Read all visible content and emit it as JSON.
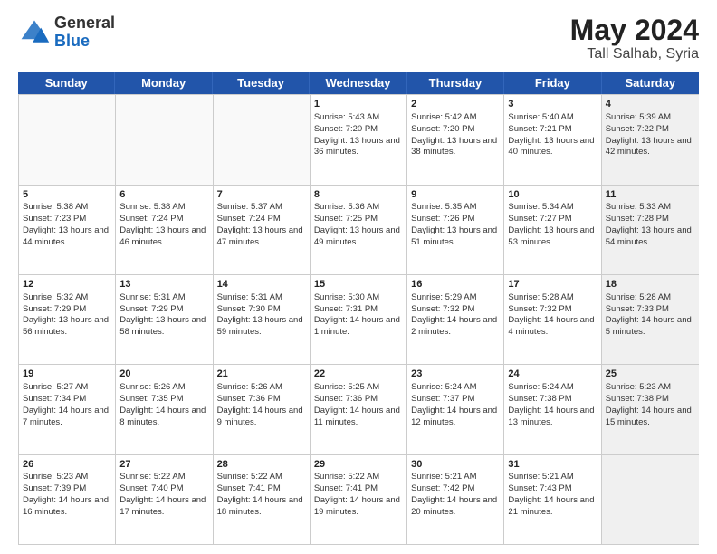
{
  "logo": {
    "general": "General",
    "blue": "Blue"
  },
  "title": {
    "month_year": "May 2024",
    "location": "Tall Salhab, Syria"
  },
  "header_days": [
    "Sunday",
    "Monday",
    "Tuesday",
    "Wednesday",
    "Thursday",
    "Friday",
    "Saturday"
  ],
  "weeks": [
    [
      {
        "day": "",
        "sunrise": "",
        "sunset": "",
        "daylight": "",
        "shaded": false,
        "empty": true
      },
      {
        "day": "",
        "sunrise": "",
        "sunset": "",
        "daylight": "",
        "shaded": false,
        "empty": true
      },
      {
        "day": "",
        "sunrise": "",
        "sunset": "",
        "daylight": "",
        "shaded": false,
        "empty": true
      },
      {
        "day": "1",
        "sunrise": "Sunrise: 5:43 AM",
        "sunset": "Sunset: 7:20 PM",
        "daylight": "Daylight: 13 hours and 36 minutes.",
        "shaded": false,
        "empty": false
      },
      {
        "day": "2",
        "sunrise": "Sunrise: 5:42 AM",
        "sunset": "Sunset: 7:20 PM",
        "daylight": "Daylight: 13 hours and 38 minutes.",
        "shaded": false,
        "empty": false
      },
      {
        "day": "3",
        "sunrise": "Sunrise: 5:40 AM",
        "sunset": "Sunset: 7:21 PM",
        "daylight": "Daylight: 13 hours and 40 minutes.",
        "shaded": false,
        "empty": false
      },
      {
        "day": "4",
        "sunrise": "Sunrise: 5:39 AM",
        "sunset": "Sunset: 7:22 PM",
        "daylight": "Daylight: 13 hours and 42 minutes.",
        "shaded": true,
        "empty": false
      }
    ],
    [
      {
        "day": "5",
        "sunrise": "Sunrise: 5:38 AM",
        "sunset": "Sunset: 7:23 PM",
        "daylight": "Daylight: 13 hours and 44 minutes.",
        "shaded": false,
        "empty": false
      },
      {
        "day": "6",
        "sunrise": "Sunrise: 5:38 AM",
        "sunset": "Sunset: 7:24 PM",
        "daylight": "Daylight: 13 hours and 46 minutes.",
        "shaded": false,
        "empty": false
      },
      {
        "day": "7",
        "sunrise": "Sunrise: 5:37 AM",
        "sunset": "Sunset: 7:24 PM",
        "daylight": "Daylight: 13 hours and 47 minutes.",
        "shaded": false,
        "empty": false
      },
      {
        "day": "8",
        "sunrise": "Sunrise: 5:36 AM",
        "sunset": "Sunset: 7:25 PM",
        "daylight": "Daylight: 13 hours and 49 minutes.",
        "shaded": false,
        "empty": false
      },
      {
        "day": "9",
        "sunrise": "Sunrise: 5:35 AM",
        "sunset": "Sunset: 7:26 PM",
        "daylight": "Daylight: 13 hours and 51 minutes.",
        "shaded": false,
        "empty": false
      },
      {
        "day": "10",
        "sunrise": "Sunrise: 5:34 AM",
        "sunset": "Sunset: 7:27 PM",
        "daylight": "Daylight: 13 hours and 53 minutes.",
        "shaded": false,
        "empty": false
      },
      {
        "day": "11",
        "sunrise": "Sunrise: 5:33 AM",
        "sunset": "Sunset: 7:28 PM",
        "daylight": "Daylight: 13 hours and 54 minutes.",
        "shaded": true,
        "empty": false
      }
    ],
    [
      {
        "day": "12",
        "sunrise": "Sunrise: 5:32 AM",
        "sunset": "Sunset: 7:29 PM",
        "daylight": "Daylight: 13 hours and 56 minutes.",
        "shaded": false,
        "empty": false
      },
      {
        "day": "13",
        "sunrise": "Sunrise: 5:31 AM",
        "sunset": "Sunset: 7:29 PM",
        "daylight": "Daylight: 13 hours and 58 minutes.",
        "shaded": false,
        "empty": false
      },
      {
        "day": "14",
        "sunrise": "Sunrise: 5:31 AM",
        "sunset": "Sunset: 7:30 PM",
        "daylight": "Daylight: 13 hours and 59 minutes.",
        "shaded": false,
        "empty": false
      },
      {
        "day": "15",
        "sunrise": "Sunrise: 5:30 AM",
        "sunset": "Sunset: 7:31 PM",
        "daylight": "Daylight: 14 hours and 1 minute.",
        "shaded": false,
        "empty": false
      },
      {
        "day": "16",
        "sunrise": "Sunrise: 5:29 AM",
        "sunset": "Sunset: 7:32 PM",
        "daylight": "Daylight: 14 hours and 2 minutes.",
        "shaded": false,
        "empty": false
      },
      {
        "day": "17",
        "sunrise": "Sunrise: 5:28 AM",
        "sunset": "Sunset: 7:32 PM",
        "daylight": "Daylight: 14 hours and 4 minutes.",
        "shaded": false,
        "empty": false
      },
      {
        "day": "18",
        "sunrise": "Sunrise: 5:28 AM",
        "sunset": "Sunset: 7:33 PM",
        "daylight": "Daylight: 14 hours and 5 minutes.",
        "shaded": true,
        "empty": false
      }
    ],
    [
      {
        "day": "19",
        "sunrise": "Sunrise: 5:27 AM",
        "sunset": "Sunset: 7:34 PM",
        "daylight": "Daylight: 14 hours and 7 minutes.",
        "shaded": false,
        "empty": false
      },
      {
        "day": "20",
        "sunrise": "Sunrise: 5:26 AM",
        "sunset": "Sunset: 7:35 PM",
        "daylight": "Daylight: 14 hours and 8 minutes.",
        "shaded": false,
        "empty": false
      },
      {
        "day": "21",
        "sunrise": "Sunrise: 5:26 AM",
        "sunset": "Sunset: 7:36 PM",
        "daylight": "Daylight: 14 hours and 9 minutes.",
        "shaded": false,
        "empty": false
      },
      {
        "day": "22",
        "sunrise": "Sunrise: 5:25 AM",
        "sunset": "Sunset: 7:36 PM",
        "daylight": "Daylight: 14 hours and 11 minutes.",
        "shaded": false,
        "empty": false
      },
      {
        "day": "23",
        "sunrise": "Sunrise: 5:24 AM",
        "sunset": "Sunset: 7:37 PM",
        "daylight": "Daylight: 14 hours and 12 minutes.",
        "shaded": false,
        "empty": false
      },
      {
        "day": "24",
        "sunrise": "Sunrise: 5:24 AM",
        "sunset": "Sunset: 7:38 PM",
        "daylight": "Daylight: 14 hours and 13 minutes.",
        "shaded": false,
        "empty": false
      },
      {
        "day": "25",
        "sunrise": "Sunrise: 5:23 AM",
        "sunset": "Sunset: 7:38 PM",
        "daylight": "Daylight: 14 hours and 15 minutes.",
        "shaded": true,
        "empty": false
      }
    ],
    [
      {
        "day": "26",
        "sunrise": "Sunrise: 5:23 AM",
        "sunset": "Sunset: 7:39 PM",
        "daylight": "Daylight: 14 hours and 16 minutes.",
        "shaded": false,
        "empty": false
      },
      {
        "day": "27",
        "sunrise": "Sunrise: 5:22 AM",
        "sunset": "Sunset: 7:40 PM",
        "daylight": "Daylight: 14 hours and 17 minutes.",
        "shaded": false,
        "empty": false
      },
      {
        "day": "28",
        "sunrise": "Sunrise: 5:22 AM",
        "sunset": "Sunset: 7:41 PM",
        "daylight": "Daylight: 14 hours and 18 minutes.",
        "shaded": false,
        "empty": false
      },
      {
        "day": "29",
        "sunrise": "Sunrise: 5:22 AM",
        "sunset": "Sunset: 7:41 PM",
        "daylight": "Daylight: 14 hours and 19 minutes.",
        "shaded": false,
        "empty": false
      },
      {
        "day": "30",
        "sunrise": "Sunrise: 5:21 AM",
        "sunset": "Sunset: 7:42 PM",
        "daylight": "Daylight: 14 hours and 20 minutes.",
        "shaded": false,
        "empty": false
      },
      {
        "day": "31",
        "sunrise": "Sunrise: 5:21 AM",
        "sunset": "Sunset: 7:43 PM",
        "daylight": "Daylight: 14 hours and 21 minutes.",
        "shaded": false,
        "empty": false
      },
      {
        "day": "",
        "sunrise": "",
        "sunset": "",
        "daylight": "",
        "shaded": true,
        "empty": true
      }
    ]
  ]
}
